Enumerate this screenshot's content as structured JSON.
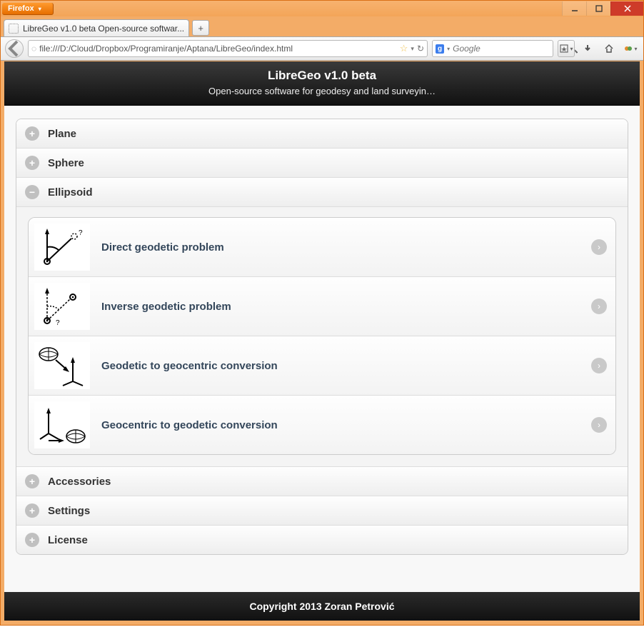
{
  "browser": {
    "name": "Firefox",
    "tab_title": "LibreGeo v1.0 beta Open-source softwar...",
    "url": "file:///D:/Cloud/Dropbox/Programiranje/Aptana/LibreGeo/index.html",
    "search_placeholder": "Google"
  },
  "page": {
    "title": "LibreGeo v1.0 beta",
    "subtitle": "Open-source software for geodesy and land surveyin…",
    "footer": "Copyright 2013 Zoran Petrović"
  },
  "accordion": [
    {
      "label": "Plane",
      "expanded": false
    },
    {
      "label": "Sphere",
      "expanded": false
    },
    {
      "label": "Ellipsoid",
      "expanded": true
    },
    {
      "label": "Accessories",
      "expanded": false
    },
    {
      "label": "Settings",
      "expanded": false
    },
    {
      "label": "License",
      "expanded": false
    }
  ],
  "ellipsoid_items": [
    {
      "label": "Direct geodetic problem"
    },
    {
      "label": "Inverse geodetic problem"
    },
    {
      "label": "Geodetic to geocentric conversion"
    },
    {
      "label": "Geocentric to geodetic conversion"
    }
  ]
}
